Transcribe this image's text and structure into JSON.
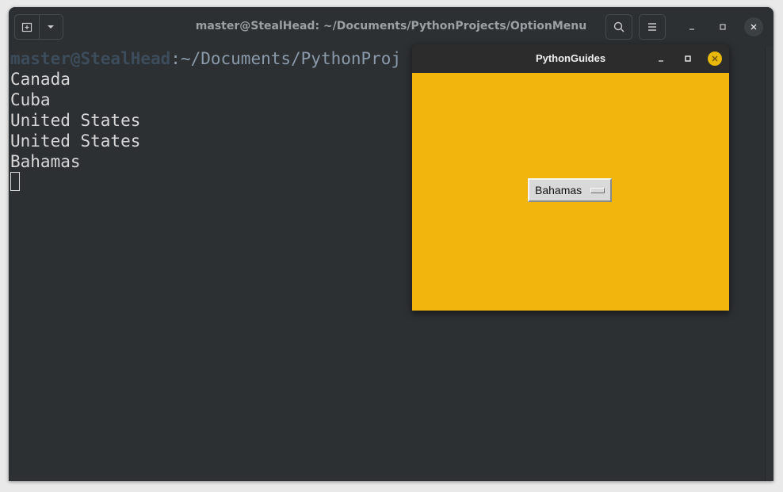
{
  "terminal": {
    "title": "master@StealHead: ~/Documents/PythonProjects/OptionMenu",
    "prompt": {
      "user": "master@StealHead",
      "path": ":~/Documents/PythonProj"
    },
    "output": [
      "Canada",
      "Cuba",
      "United States",
      "United States",
      "Bahamas"
    ],
    "icons": {
      "new_tab": "new-tab-icon",
      "dropdown": "chevron-down-icon",
      "search": "search-icon",
      "menu": "hamburger-menu-icon",
      "minimize": "minimize-icon",
      "maximize": "maximize-icon",
      "close": "close-icon"
    }
  },
  "tk_window": {
    "title": "PythonGuides",
    "background": "#f1b50e",
    "option_menu": {
      "selected": "Bahamas"
    }
  },
  "colors": {
    "terminal_bg": "#2c3033",
    "tk_bg": "#f1b50e",
    "close_button": "#e8b80b"
  }
}
